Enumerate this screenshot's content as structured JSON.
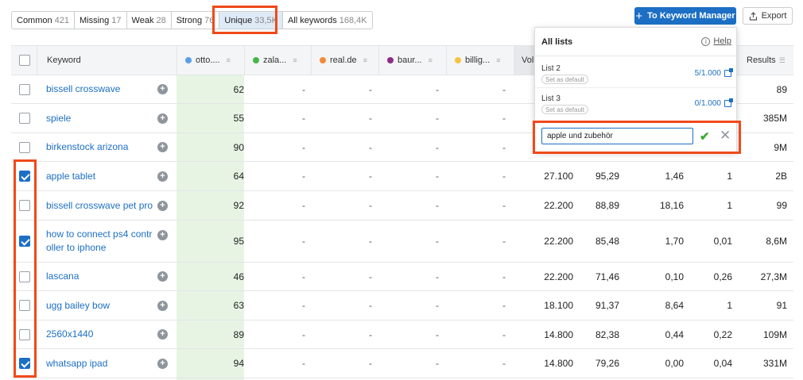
{
  "filters": [
    {
      "label": "Common",
      "count": "421",
      "active": false
    },
    {
      "label": "Missing",
      "count": "17",
      "active": false
    },
    {
      "label": "Weak",
      "count": "28",
      "active": false
    },
    {
      "label": "Strong",
      "count": "76",
      "active": false
    },
    {
      "label": "Unique",
      "count": "33,5K",
      "active": true
    },
    {
      "label": "All keywords",
      "count": "168,4K",
      "active": false
    }
  ],
  "toolbar": {
    "keyword_manager_label": "To Keyword Manager",
    "export_label": "Export"
  },
  "table": {
    "headers": {
      "keyword": "Keyword",
      "volume": "Vol",
      "results": "Results",
      "domains": [
        {
          "label": "otto....",
          "color": "#5b9ee6"
        },
        {
          "label": "zala...",
          "color": "#45b649"
        },
        {
          "label": "real.de",
          "color": "#f28a3b"
        },
        {
          "label": "baur...",
          "color": "#8e2a8a"
        },
        {
          "label": "billig...",
          "color": "#f5c342"
        }
      ]
    },
    "rows": [
      {
        "keyword": "bissell crosswave",
        "checked": false,
        "otto": "62",
        "d2": "-",
        "d3": "-",
        "d4": "-",
        "d5": "-",
        "vol": "",
        "kd": "",
        "cpc": "",
        "com": "",
        "results": "89"
      },
      {
        "keyword": "spiele",
        "checked": false,
        "otto": "55",
        "d2": "-",
        "d3": "-",
        "d4": "-",
        "d5": "-",
        "vol": "",
        "kd": "",
        "cpc": "",
        "com": "",
        "results": "385M"
      },
      {
        "keyword": "birkenstock arizona",
        "checked": false,
        "otto": "90",
        "d2": "-",
        "d3": "-",
        "d4": "-",
        "d5": "-",
        "vol": "",
        "kd": "",
        "cpc": "",
        "com": "",
        "results": "9M"
      },
      {
        "keyword": "apple tablet",
        "checked": true,
        "otto": "64",
        "d2": "-",
        "d3": "-",
        "d4": "-",
        "d5": "-",
        "vol": "27.100",
        "kd": "95,29",
        "cpc": "1,46",
        "com": "1",
        "results": "2B"
      },
      {
        "keyword": "bissell crosswave pet pro",
        "checked": false,
        "otto": "92",
        "d2": "-",
        "d3": "-",
        "d4": "-",
        "d5": "-",
        "vol": "22.200",
        "kd": "88,89",
        "cpc": "18,16",
        "com": "1",
        "results": "99"
      },
      {
        "keyword": "how to connect ps4 controller to iphone",
        "checked": true,
        "otto": "95",
        "d2": "-",
        "d3": "-",
        "d4": "-",
        "d5": "-",
        "vol": "22.200",
        "kd": "85,48",
        "cpc": "1,70",
        "com": "0,01",
        "results": "8,6M"
      },
      {
        "keyword": "lascana",
        "checked": false,
        "otto": "46",
        "d2": "-",
        "d3": "-",
        "d4": "-",
        "d5": "-",
        "vol": "22.200",
        "kd": "71,46",
        "cpc": "0,10",
        "com": "0,26",
        "results": "27,3M"
      },
      {
        "keyword": "ugg bailey bow",
        "checked": false,
        "otto": "63",
        "d2": "-",
        "d3": "-",
        "d4": "-",
        "d5": "-",
        "vol": "18.100",
        "kd": "91,37",
        "cpc": "8,64",
        "com": "1",
        "results": "91"
      },
      {
        "keyword": "2560x1440",
        "checked": false,
        "otto": "89",
        "d2": "-",
        "d3": "-",
        "d4": "-",
        "d5": "-",
        "vol": "14.800",
        "kd": "82,38",
        "cpc": "0,44",
        "com": "0,22",
        "results": "109M"
      },
      {
        "keyword": "whatsapp ipad",
        "checked": true,
        "otto": "94",
        "d2": "-",
        "d3": "-",
        "d4": "-",
        "d5": "-",
        "vol": "14.800",
        "kd": "79,26",
        "cpc": "0,00",
        "com": "0,04",
        "results": "331M"
      }
    ]
  },
  "popup": {
    "title": "All lists",
    "help_label": "Help",
    "lists": [
      {
        "name": "List 2",
        "default_label": "Set as default",
        "count": "5/1.000"
      },
      {
        "name": "List 3",
        "default_label": "Set as default",
        "count": "0/1.000"
      }
    ],
    "new_list_value": "apple und zubehör"
  }
}
